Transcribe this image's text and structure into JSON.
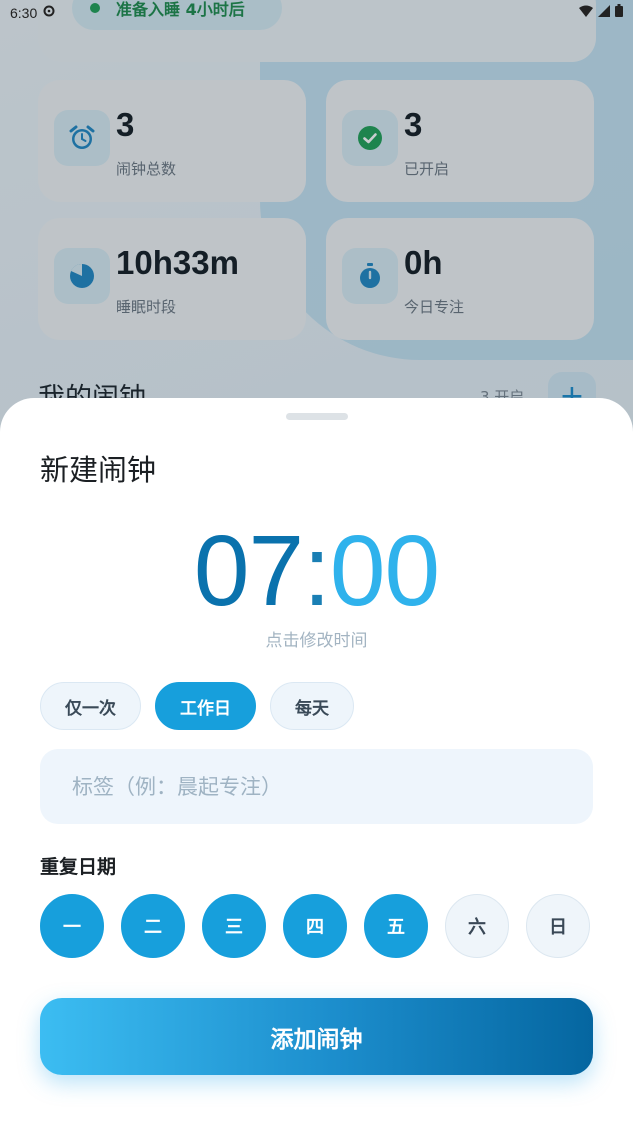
{
  "status_bar": {
    "time": "6:30"
  },
  "background": {
    "sleep_banner": "准备入睡  4小时后",
    "stats": [
      {
        "value": "3",
        "label": "闹钟总数",
        "icon": "alarm-clock-icon"
      },
      {
        "value": "3",
        "label": "已开启",
        "icon": "check-circle-icon"
      },
      {
        "value": "10h33m",
        "label": "睡眠时段",
        "icon": "sleep-moon-icon"
      },
      {
        "value": "0h",
        "label": "今日专注",
        "icon": "stopwatch-icon"
      }
    ],
    "section_title": "我的闹钟",
    "section_count": "3 开启",
    "add_symbol": "+"
  },
  "sheet": {
    "title": "新建闹钟",
    "time": {
      "hour": "07",
      "separator": ":",
      "minute": "00"
    },
    "time_hint": "点击修改时间",
    "presets": [
      {
        "label": "仅一次",
        "active": false
      },
      {
        "label": "工作日",
        "active": true
      },
      {
        "label": "每天",
        "active": false
      }
    ],
    "label_placeholder": "标签（例：晨起专注）",
    "repeat_title": "重复日期",
    "days": [
      {
        "label": "一",
        "on": true
      },
      {
        "label": "二",
        "on": true
      },
      {
        "label": "三",
        "on": true
      },
      {
        "label": "四",
        "on": true
      },
      {
        "label": "五",
        "on": true
      },
      {
        "label": "六",
        "on": false
      },
      {
        "label": "日",
        "on": false
      }
    ],
    "add_button": "添加闹钟"
  },
  "colors": {
    "accent": "#179fdc",
    "time_hour": "#0a72ad",
    "time_minute": "#2fb2ec",
    "success_green": "#1f9f55"
  }
}
